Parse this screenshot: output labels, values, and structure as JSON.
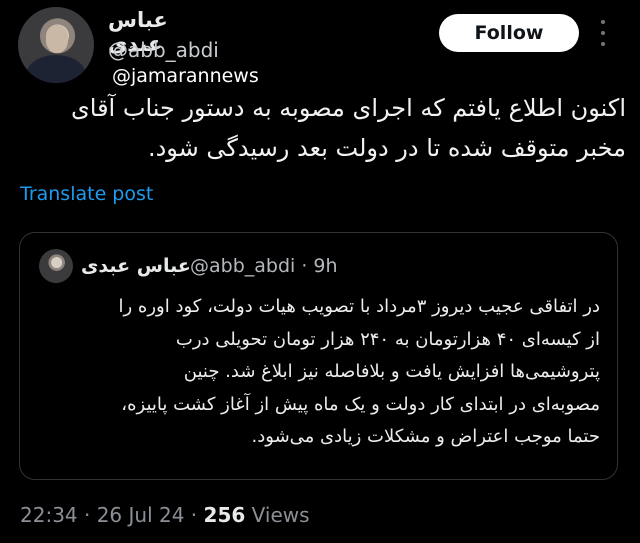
{
  "author": {
    "name": "عباس عبدی",
    "handle": "@abb_abdi",
    "mention": "@jamarannews",
    "follow_label": "Follow"
  },
  "tweet": {
    "lines": [
      "اکنون اطلاع یافتم که اجرای مصوبه به دستور جناب آقای",
      "مخبر متوقف شده تا در دولت بعد رسیدگی شود."
    ],
    "translate_label": "Translate post"
  },
  "quote": {
    "name": "عباس عبدی",
    "handle_time": "@abb_abdi · 9h",
    "lines": [
      "در اتفاقی عجیب دیروز ۳مرداد با تصویب هیات دولت، کود اوره را",
      "از کیسه‌ای ۴۰ هزارتومان به ۲۴۰ هزار تومان تحویلی درب",
      "پتروشیمی‌ها افزایش یافت و بلافاصله نیز ابلاغ شد. چنین",
      "مصوبه‌ای در ابتدای کار دولت و یک ماه پیش از آغاز کشت پاییزه،",
      "حتما موجب اعتراض و مشکلات زیادی می‌شود."
    ]
  },
  "meta": {
    "datetime": "22:34 · 26 Jul 24 · ",
    "views_count": "256",
    "views_label": " Views"
  },
  "colors": {
    "background": "#000000",
    "link": "#1d9bf0",
    "muted": "#71767b",
    "button_bg": "#ffffff"
  }
}
